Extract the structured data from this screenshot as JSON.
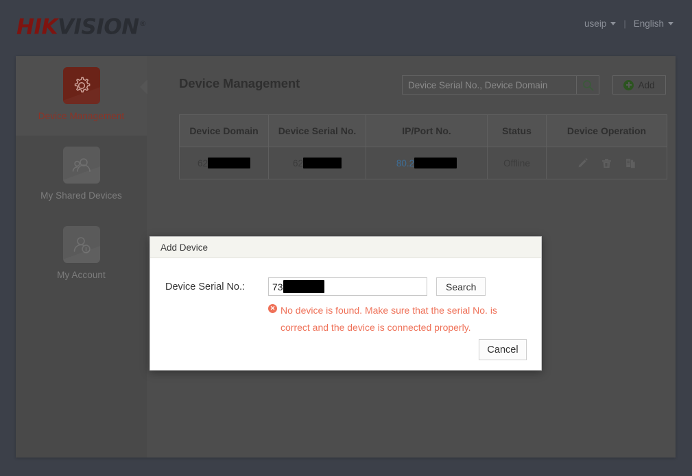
{
  "header": {
    "brand_hik": "HIK",
    "brand_vision": "VISION",
    "brand_reg": "®",
    "account_label": "useip",
    "separator": "|",
    "language_label": "English"
  },
  "sidebar": {
    "items": [
      {
        "label": "Device Management",
        "icon": "gear-icon",
        "active": true
      },
      {
        "label": "My Shared Devices",
        "icon": "people-icon",
        "active": false
      },
      {
        "label": "My Account",
        "icon": "person-info-icon",
        "active": false
      }
    ]
  },
  "content": {
    "page_title": "Device Management",
    "search": {
      "placeholder": "Device Serial No., Device Domain",
      "value": "",
      "icon": "search-icon"
    },
    "add_button": {
      "label": "Add",
      "icon": "plus-circle-icon"
    },
    "table": {
      "columns": [
        "Device Domain",
        "Device Serial No.",
        "IP/Port No.",
        "Status",
        "Device Operation"
      ],
      "rows": [
        {
          "device_domain": "62",
          "device_domain_redacted": true,
          "device_serial": "62",
          "device_serial_redacted": true,
          "ip_port": "80.2",
          "ip_port_redacted": true,
          "status": "Offline",
          "operations": [
            "edit-icon",
            "delete-icon",
            "copy-icon"
          ]
        }
      ]
    }
  },
  "modal": {
    "title": "Add Device",
    "serial_label": "Device Serial No.:",
    "serial_value": "73",
    "serial_redacted": true,
    "search_label": "Search",
    "error_icon_glyph": "✕",
    "error_message": "No device is found. Make sure that the serial No. is correct and the device is connected properly.",
    "cancel_label": "Cancel"
  },
  "colors": {
    "page_background": "#3c4049",
    "panel_background": "#4d4d4d",
    "sidebar_background": "#494949",
    "brand_red": "#7e1410",
    "active_icon_background": "#6b2318",
    "active_label": "#8e3326",
    "status_offline": "#8c4b2a",
    "ip_link": "#3d6d96",
    "error_red": "#ef7158",
    "add_plus_green": "#2c5420",
    "modal_background": "#ffffff",
    "modal_titlebar": "#f4f4ef"
  }
}
